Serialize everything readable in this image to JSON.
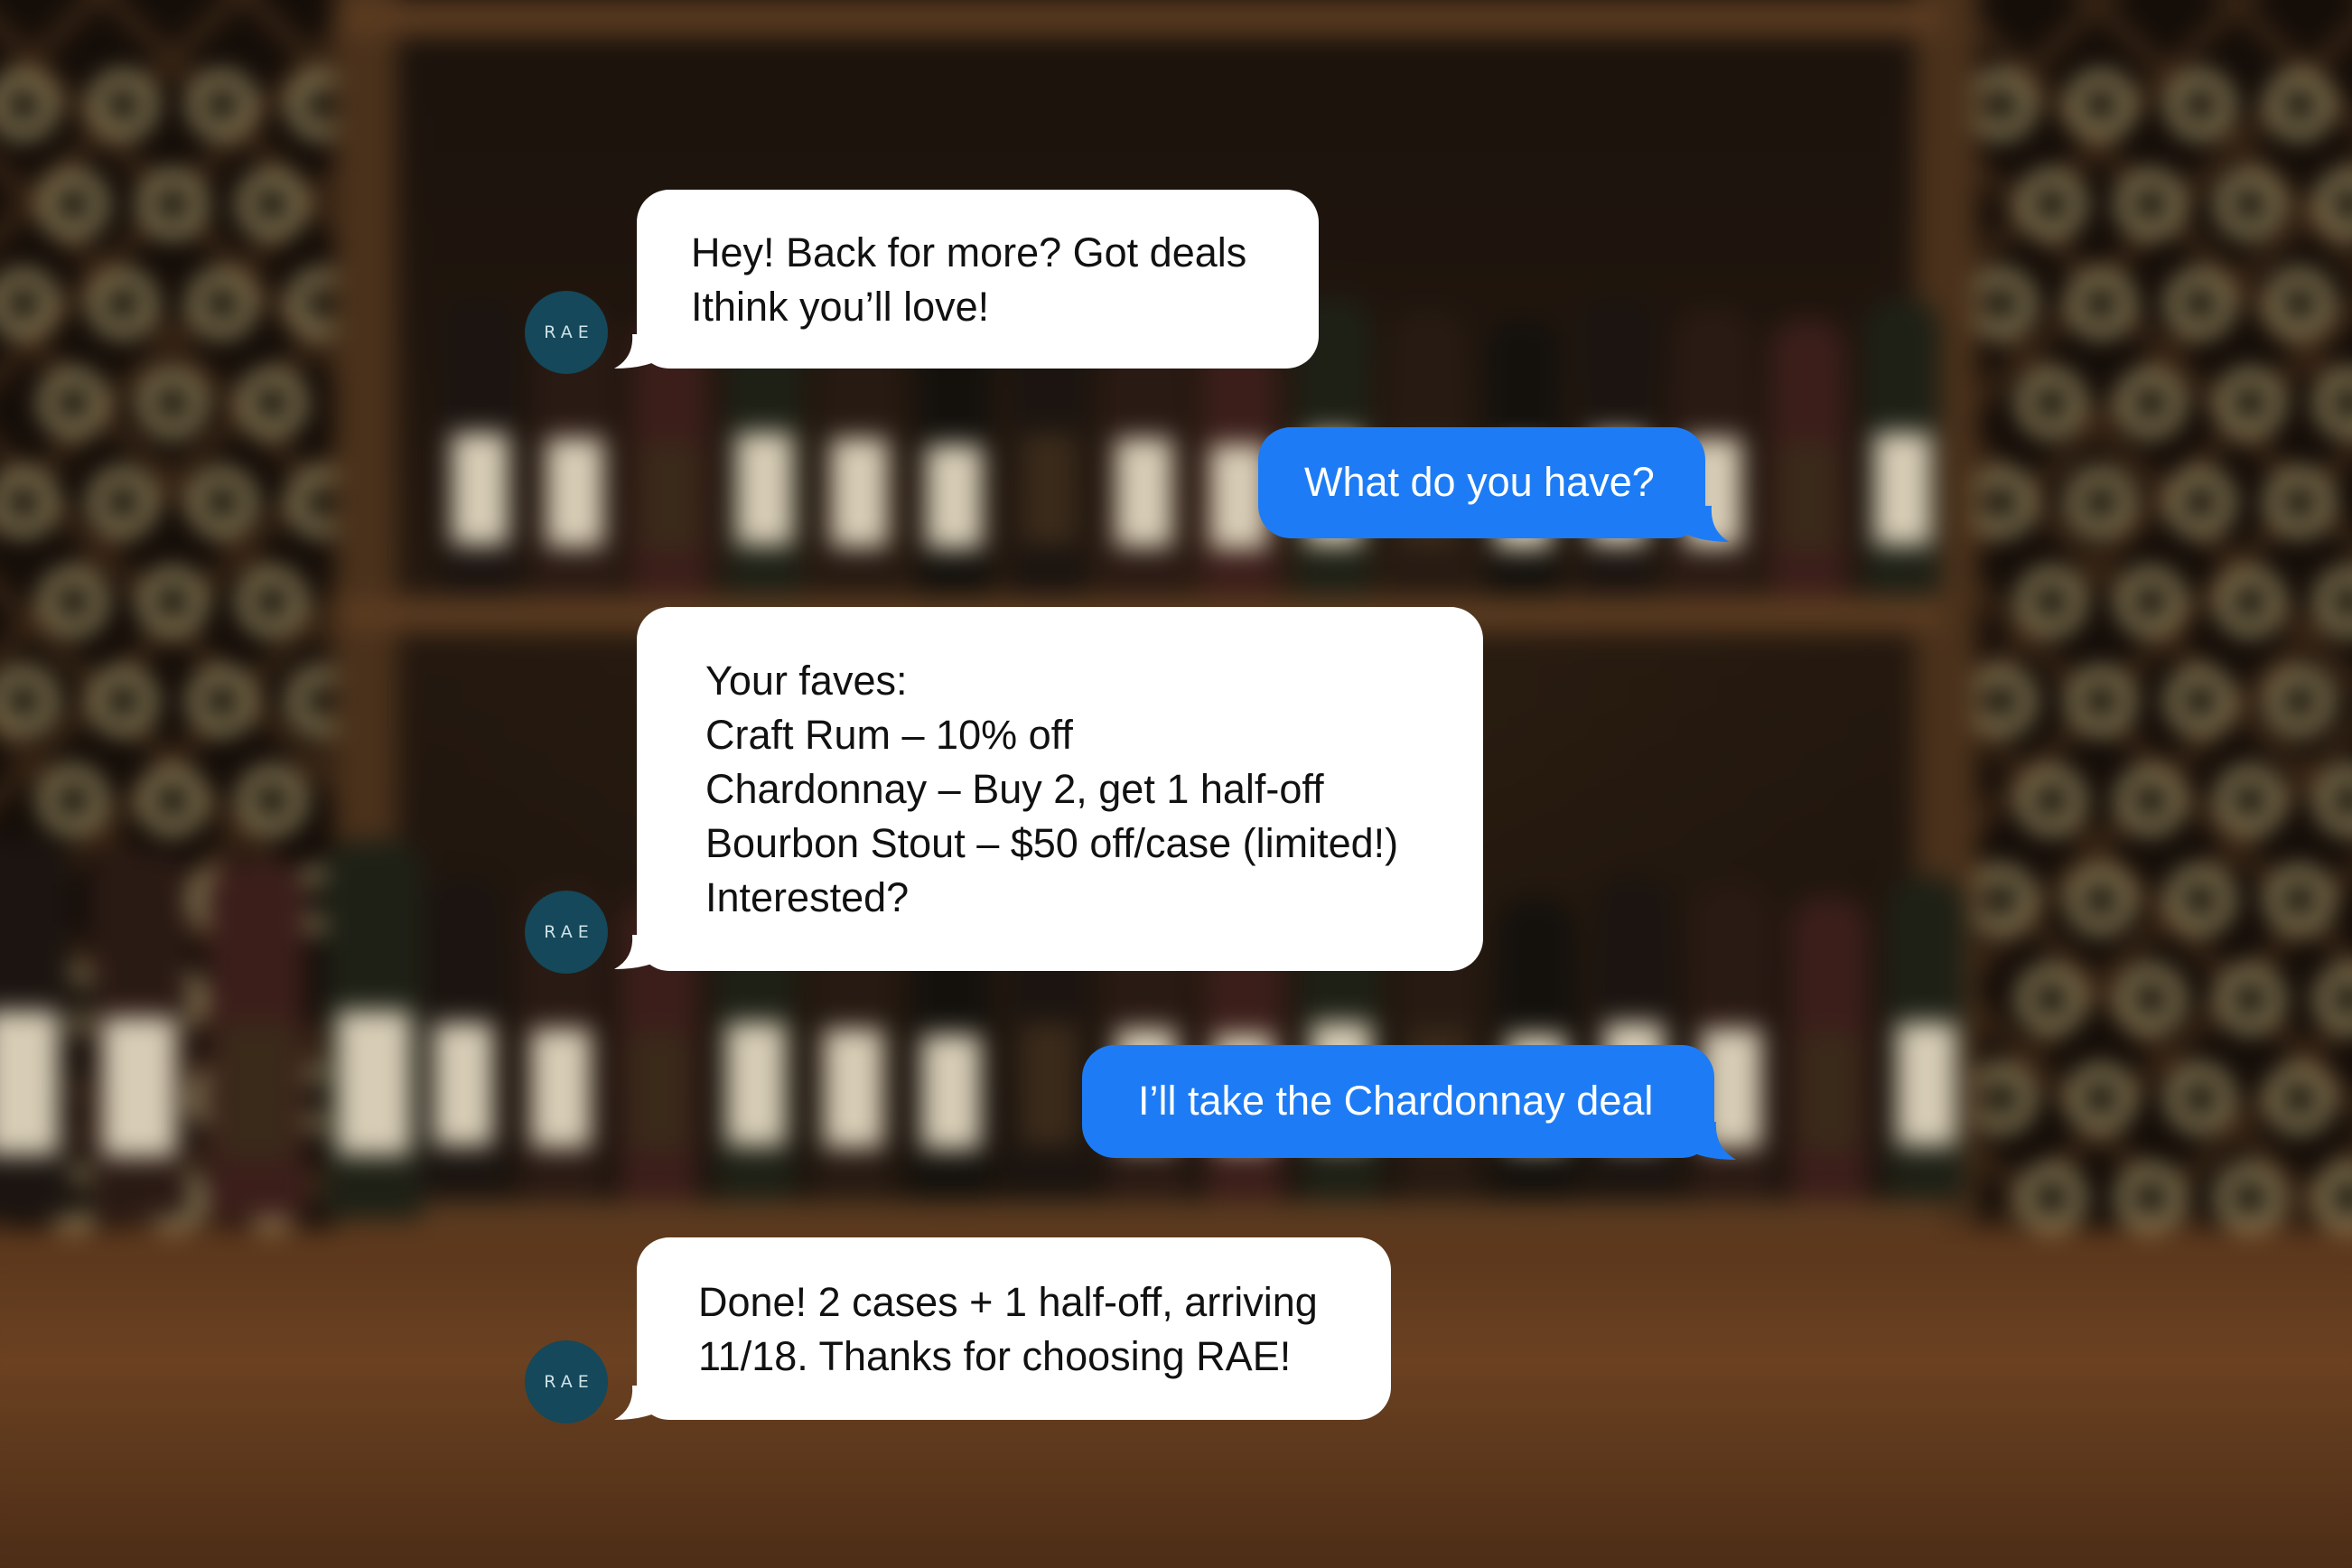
{
  "brand": {
    "avatar_label": "RAE",
    "incoming_bubble_color": "#ffffff",
    "outgoing_bubble_color": "#1d7cf5",
    "avatar_color": "#14485a"
  },
  "messages": [
    {
      "sender": "RAE",
      "direction": "incoming",
      "lines": [
        "Hey! Back for more? Got deals",
        "Ithink you’ll love!"
      ]
    },
    {
      "sender": "user",
      "direction": "outgoing",
      "lines": [
        "What do you have?"
      ]
    },
    {
      "sender": "RAE",
      "direction": "incoming",
      "lines": [
        "Your faves:",
        "Craft Rum – 10% off",
        "Chardonnay – Buy 2, get 1 half-off",
        "Bourbon Stout – $50 off/case (limited!)",
        "Interested?"
      ]
    },
    {
      "sender": "user",
      "direction": "outgoing",
      "lines": [
        "I’ll take the Chardonnay deal"
      ]
    },
    {
      "sender": "RAE",
      "direction": "incoming",
      "lines": [
        "Done! 2 cases + 1 half-off, arriving",
        "11/18. Thanks for choosing RAE!"
      ]
    }
  ]
}
